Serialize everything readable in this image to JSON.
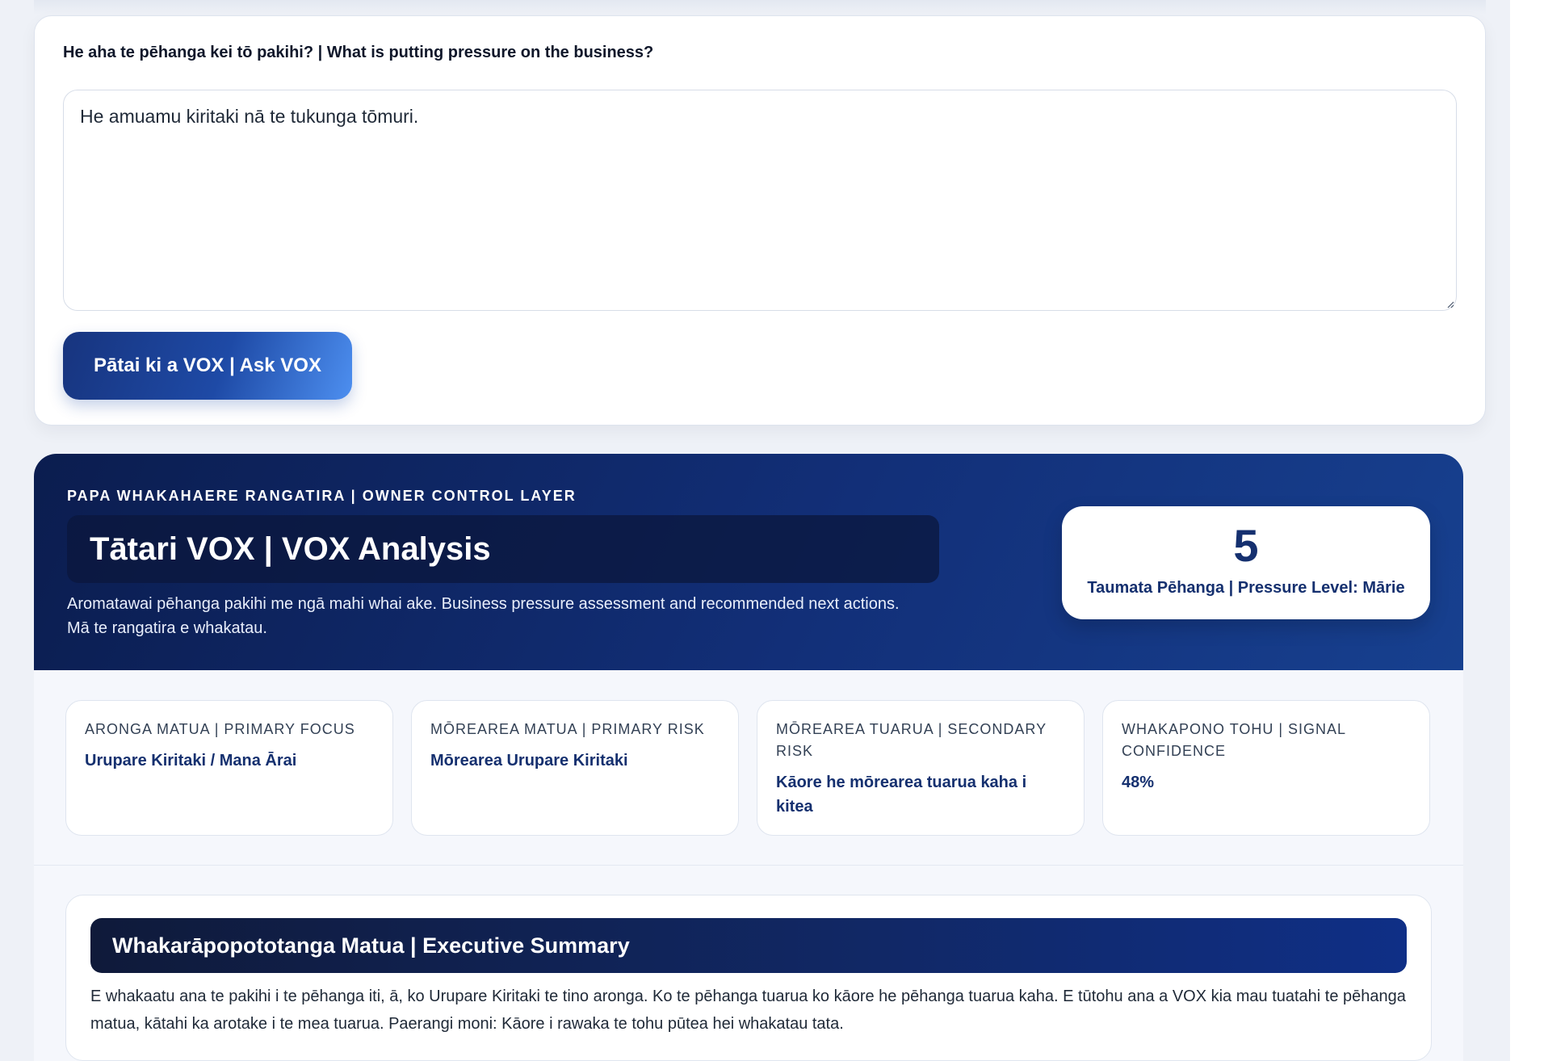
{
  "ask": {
    "label": "He aha te pēhanga kei tō pakihi? | What is putting pressure on the business?",
    "input_value": "He amuamu kiritaki nā te tukunga tōmuri.",
    "button_label": "Pātai ki a VOX | Ask VOX"
  },
  "analysis": {
    "eyebrow": "PAPA WHAKAHAERE RANGATIRA | OWNER CONTROL LAYER",
    "title": "Tātari VOX | VOX Analysis",
    "description_line1": "Aromatawai pēhanga pakihi me ngā mahi whai ake. Business pressure assessment and recommended next actions.",
    "description_line2": "Mā te rangatira e whakatau.",
    "pressure": {
      "value": "5",
      "label": "Taumata Pēhanga | Pressure Level: Mārie"
    }
  },
  "metrics": [
    {
      "label": "Aronga Matua | Primary Focus",
      "value": "Urupare Kiritaki / Mana Ārai"
    },
    {
      "label": "Mōrearea Matua | Primary Risk",
      "value": "Mōrearea Urupare Kiritaki"
    },
    {
      "label": "Mōrearea Tuarua | Secondary Risk",
      "value": "Kāore he mōrearea tuarua kaha i kitea"
    },
    {
      "label": "Whakapono Tohu | Signal Confidence",
      "value": "48%"
    }
  ],
  "summary": {
    "heading": "Whakarāpopototanga Matua | Executive Summary",
    "text": "E whakaatu ana te pakihi i te pēhanga iti, ā, ko Urupare Kiritaki te tino aronga. Ko te pēhanga tuarua ko kāore he pēhanga tuarua kaha. E tūtohu ana a VOX kia mau tuatahi te pēhanga matua, kātahi ka arotake i te mea tuarua. Paerangi moni: Kāore i rawaka te tohu pūtea hei whakatau tata."
  },
  "colors": {
    "navy": "#0b1d4f",
    "accent_blue": "#15306f",
    "button_gradient_end": "#4d8ff0",
    "page_bg": "#eef1f7"
  }
}
